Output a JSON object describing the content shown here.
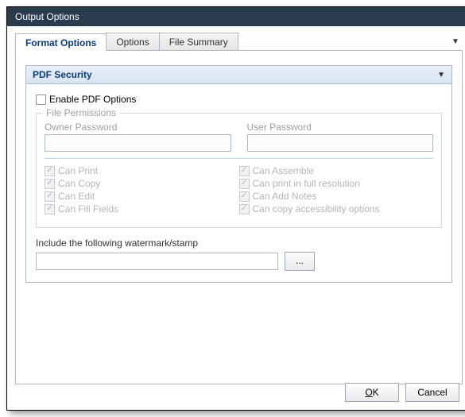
{
  "window": {
    "title": "Output Options"
  },
  "tabs": {
    "items": [
      {
        "label": "Format Options"
      },
      {
        "label": "Options"
      },
      {
        "label": "File Summary"
      }
    ]
  },
  "section": {
    "title": "PDF Security"
  },
  "enable": {
    "label": "Enable PDF Options"
  },
  "permissions": {
    "legend": "File Permissions",
    "owner_label": "Owner Password",
    "user_label": "User Password",
    "owner_value": "",
    "user_value": "",
    "left": [
      {
        "label": "Can Print"
      },
      {
        "label": "Can Copy"
      },
      {
        "label": "Can Edit"
      },
      {
        "label": "Can Fill Fields"
      }
    ],
    "right": [
      {
        "label": "Can Assemble"
      },
      {
        "label": "Can print in full resolution"
      },
      {
        "label": "Can Add Notes"
      },
      {
        "label": "Can copy accessibility options"
      }
    ]
  },
  "watermark": {
    "label": "Include the following watermark/stamp",
    "value": "",
    "browse": "..."
  },
  "footer": {
    "ok": "OK",
    "cancel": "Cancel"
  }
}
